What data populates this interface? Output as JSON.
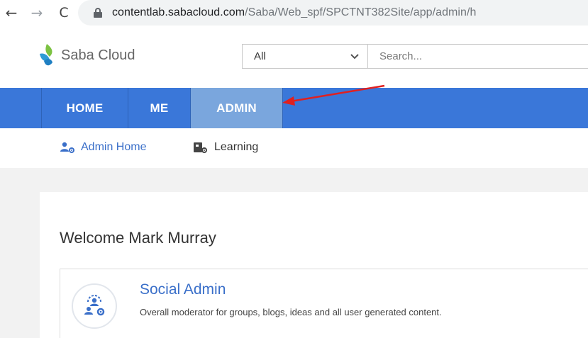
{
  "browser": {
    "back_icon": "←",
    "forward_icon": "→",
    "reload_icon": "C",
    "url_domain": "contentlab.sabacloud.com",
    "url_path": "/Saba/Web_spf/SPCTNT382Site/app/admin/h"
  },
  "header": {
    "logo_text": "Saba Cloud",
    "search_scope": "All",
    "search_placeholder": "Search..."
  },
  "main_nav": {
    "tabs": [
      {
        "label": "HOME"
      },
      {
        "label": "ME"
      },
      {
        "label": "ADMIN",
        "active": true
      }
    ]
  },
  "sub_nav": {
    "items": [
      {
        "label": "Admin Home",
        "icon": "admin-user-gear-icon"
      },
      {
        "label": "Learning",
        "icon": "learning-gear-icon"
      }
    ]
  },
  "content": {
    "welcome": "Welcome Mark Murray",
    "cards": [
      {
        "title": "Social Admin",
        "description": "Overall moderator for groups, blogs, ideas and all user generated content.",
        "icon": "social-admin-icon"
      }
    ]
  },
  "colors": {
    "nav_blue": "#3a77d9",
    "active_tab": "#7aa6dd",
    "link_blue": "#3a6fc9",
    "annotation_arrow": "#e02020"
  }
}
